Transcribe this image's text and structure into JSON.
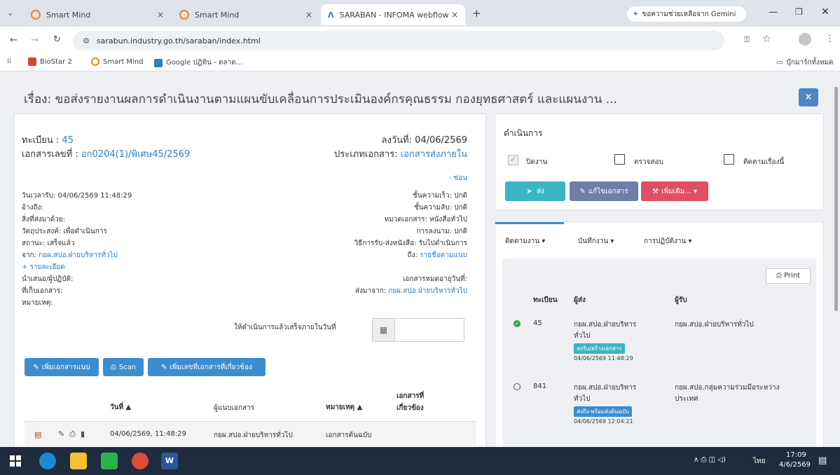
{
  "browser": {
    "tabs": [
      {
        "label": "Smart Mind"
      },
      {
        "label": "Smart Mind"
      },
      {
        "label": "SARABAN - INFOMA webflow"
      }
    ],
    "new_tab": "+",
    "gemini_label": "ขอความช่วยเหลือจาก Gemini",
    "url": "sarabun.industry.go.th/saraban/index.html",
    "bookmarks": [
      "BioStar 2",
      "Smart Mind",
      "Google ปฏิทิน - ตลาด..."
    ],
    "all_bookmarks": "บุ๊กมาร์กทั้งหมด"
  },
  "page": {
    "title": "เรื่อง: ขอส่งรายงานผลการดำเนินงานตามแผนขับเคลื่อนการประเมินองค์กรคุณธรรม กองยุทธศาสตร์ และแผนงาน ...",
    "close": "×"
  },
  "doc": {
    "reg_label": "ทะเบียน :",
    "reg_value": "45",
    "docno_label": "เอกสารเลขที่ :",
    "docno_value": "อก0204(1)/พิเศษ45/2569",
    "date_label": "ลงวันที่: 04/06/2569",
    "type_label": "ประเภทเอกสาร:",
    "type_value": "เอกสารส่งภายใน",
    "hide_link": "- ซ่อน",
    "left_fields": [
      "วันเวลารับ: 04/06/2569 11:48:29",
      "อ้างถึง:",
      "สิ่งที่ส่งมาด้วย:",
      "วัตถุประสงค์: เพื่อดำเนินการ",
      "สถานะ: เสร็จแล้ว"
    ],
    "from_label": "จาก:",
    "from_value": "กยผ.สปอ.ฝ่ายบริหารทั่วไป",
    "details_link": "+ รายละเอียด",
    "left_fields2": [
      "นำเสนอ/ผู้ปฏิบัติ:",
      "ที่เก็บเอกสาร:",
      "หมายเหตุ:"
    ],
    "right_fields": [
      "ชั้นความเร็ว: ปกติ",
      "ชั้นความลับ: ปกติ",
      "หมวดเอกสาร: หนังสือทั่วไป",
      "การลงนาม: ปกติ",
      "วิธีการรับ-ส่งหนังสือ: รับไปดำเนินการ"
    ],
    "to_label": "ถึง:",
    "to_value": "รายชื่อตามแนบ",
    "expire_label": "เอกสารหมดอายุวันที่:",
    "sentfrom_label": "ส่งมาจาก:",
    "sentfrom_value": "กยผ.สปอ.ฝ่ายบริหารทั่วไป",
    "deadline_label": "ให้ดำเนินการแล้วเสร็จภายในวันที่",
    "btn_attach": "เพิ่มเอกสารแนบ",
    "btn_scan": "Scan",
    "btn_related": "เพิ่มเลขที่เอกสารที่เกี่ยวข้อง",
    "table_headers": [
      "วันที่ ▲",
      "ผู้แนบเอกสาร",
      "หมายเหตุ ▲",
      "เอกสารที่",
      "เกี่ยวข้อง"
    ],
    "table_row": {
      "date": "04/06/2569, 11:48:29",
      "by": "กยผ.สปอ.ฝ่ายบริหารทั่วไป",
      "note": "เอกสารต้นฉบับ"
    }
  },
  "action": {
    "heading": "ดำเนินการ",
    "checks": [
      {
        "label": "ปิดงาน",
        "checked": true
      },
      {
        "label": "ตรวจสอบ",
        "checked": false
      },
      {
        "label": "ติดตามเรื่องนี้",
        "checked": false
      }
    ],
    "btn_send": "ส่ง",
    "btn_edit": "แก้ไขเอกสาร",
    "btn_more": "เพิ่มเติม... ▾"
  },
  "track": {
    "tabs": [
      "ติดตามงาน ▾",
      "บันทึกงาน ▾",
      "การปฏิบัติงาน ▾"
    ],
    "print": "Print",
    "headers": [
      "ทะเบียน",
      "ผู้ส่ง",
      "ผู้รับ"
    ],
    "rows": [
      {
        "reg": "45",
        "sender1": "กยผ.สปอ.ฝ่ายบริหาร",
        "sender2": "ทั่วไป",
        "badge": "ลงรับ/สร้างเอกสาร",
        "time": "04/06/2569 11:48:29",
        "receiver1": "กยผ.สปอ.ฝ่ายบริหารทั่วไป",
        "receiver2": ""
      },
      {
        "reg": "841",
        "sender1": "กยผ.สปอ.ฝ่ายบริหาร",
        "sender2": "ทั่วไป",
        "badge": "ส่งถึง-พร้อมส่งต้นฉบับ",
        "time": "04/06/2569 12:04:21",
        "receiver1": "กยผ.สปอ.กลุ่มความร่วมมือระหว่าง",
        "receiver2": "ประเทศ"
      }
    ]
  },
  "taskbar": {
    "time": "17:09",
    "date": "4/6/2569",
    "lang": "ไทย"
  }
}
